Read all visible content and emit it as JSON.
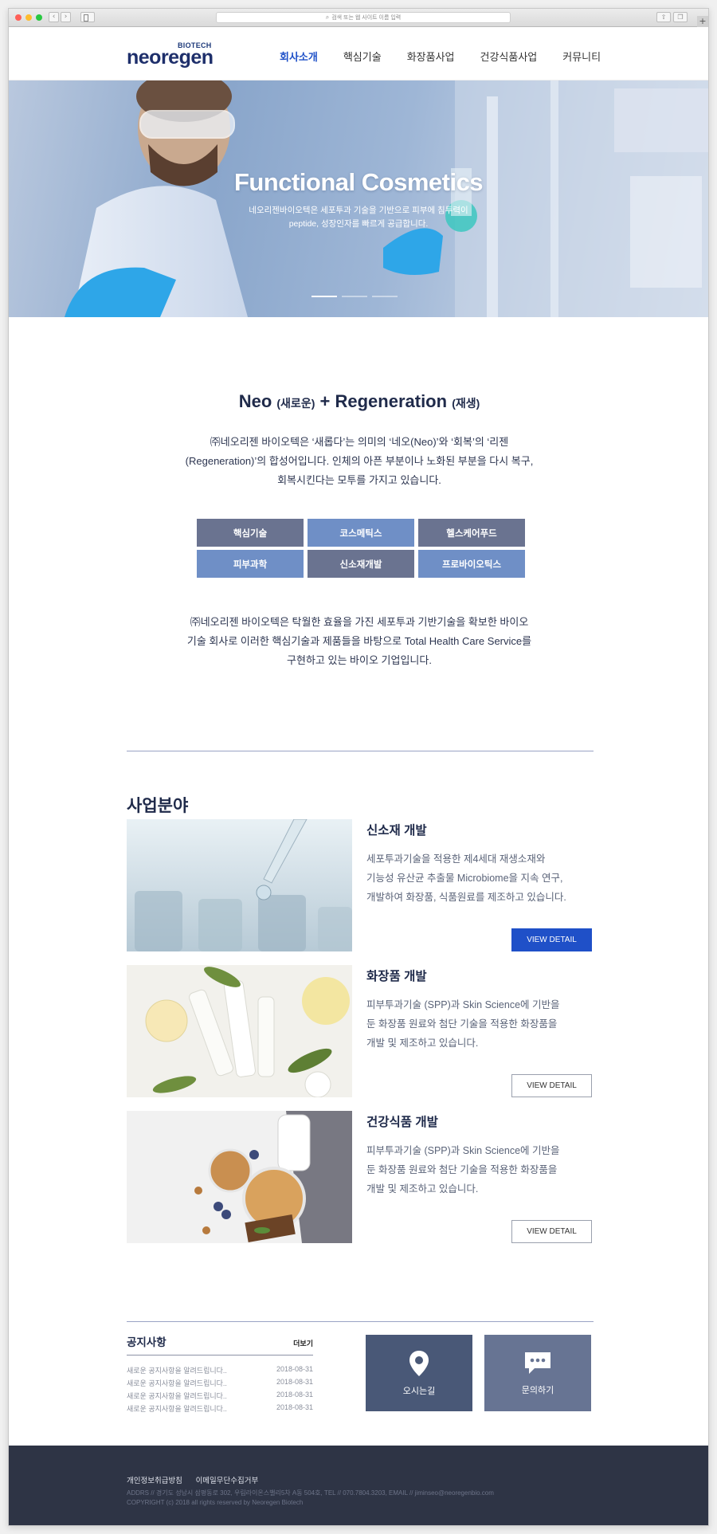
{
  "browser": {
    "url_placeholder": "검색 또는 웹 사이트 이름 입력",
    "colors": {
      "close": "#ff5f57",
      "minimize": "#febc2e",
      "zoom": "#28c840"
    }
  },
  "site": {
    "logo_sub": "BIOTECH",
    "logo_text": "neoregen",
    "nav": [
      {
        "label": "회사소개",
        "active": true
      },
      {
        "label": "핵심기술"
      },
      {
        "label": "화장품사업"
      },
      {
        "label": "건강식품사업"
      },
      {
        "label": "커뮤니티"
      }
    ],
    "accent": "#1f50c8"
  },
  "hero": {
    "title": "Functional Cosmetics",
    "subtitle_line1": "네오리젠바이오텍은 세포투과 기술을 기반으로 피부에 침투력이",
    "subtitle_line2": "peptide, 성장인자를 빠르게 공급합니다."
  },
  "intro": {
    "title_neo": "Neo",
    "title_neo_ko": "(새로운)",
    "title_plus": "+",
    "title_regen": "Regeneration",
    "title_regen_ko": "(재생)",
    "desc1_line1": "㈜네오리젠 바이오텍은 ‘새롭다’는 의미의 ‘네오(Neo)’와 ‘회복’의 ‘리젠",
    "desc1_line2": "(Regeneration)’의 합성어입니다. 인체의 아픈 부분이나 노화된 부분을 다시 복구,",
    "desc1_line3": "회복시킨다는 모투를 가지고 있습니다.",
    "chips": [
      "핵심기술",
      "코스메틱스",
      "헬스케어푸드",
      "피부과학",
      "신소재개발",
      "프로바이오틱스"
    ],
    "desc2_line1": "㈜네오리젠 바이오텍은 탁월한 효율을 가진 세포투과 기반기술을 확보한 바이오",
    "desc2_line2": "기술 회사로 이러한 핵심기술과 제품들을 바탕으로 Total Health Care Service를",
    "desc2_line3": "구현하고 있는 바이오 기업입니다."
  },
  "business": {
    "title": "사업분야",
    "items": [
      {
        "title": "신소재 개발",
        "line1": "세포투과기술을 적용한 제4세대 재생소재와",
        "line2": "기능성 유산균 추출물 Microbiome을 지속 연구,",
        "line3": "개발하여 화장품, 식품원료를 제조하고 있습니다.",
        "button": "VIEW DETAIL"
      },
      {
        "title": "화장품 개발",
        "line1": "피부투과기술 (SPP)과 Skin Science에 기반을",
        "line2": "둔 화장품 원료와 첨단 기술을 적용한 화장품을",
        "line3": "개발 및 제조하고 있습니다.",
        "button": "VIEW DETAIL"
      },
      {
        "title": "건강식품 개발",
        "line1": "피부투과기술 (SPP)과 Skin Science에 기반을",
        "line2": "둔 화장품 원료와 첨단 기술을 적용한 화장품을",
        "line3": "개발 및 제조하고 있습니다.",
        "button": "VIEW DETAIL"
      }
    ]
  },
  "notice": {
    "title": "공지사항",
    "more": "더보기",
    "items": [
      {
        "text": "새로운 공지사항을 알려드립니다..",
        "date": "2018-08-31"
      },
      {
        "text": "새로운 공지사항을 알려드립니다..",
        "date": "2018-08-31"
      },
      {
        "text": "새로운 공지사항을 알려드립니다..",
        "date": "2018-08-31"
      },
      {
        "text": "새로운 공지사항을 알려드립니다..",
        "date": "2018-08-31"
      }
    ]
  },
  "quick": {
    "location": "오시는길",
    "inquiry": "문의하기"
  },
  "footer": {
    "privacy": "개인정보취급방침",
    "email_policy": "이메일무단수집거부",
    "address": "ADDRS // 경기도 성남시 삼평동로 302, 우림라이온스밸리5차 A동 504호, TEL // 070.7804.3203, EMAIL // jiminseo@neoregenbio.com",
    "copyright": "COPYRIGHT (c) 2018 all rights reserved by Neoregen Biotech"
  }
}
